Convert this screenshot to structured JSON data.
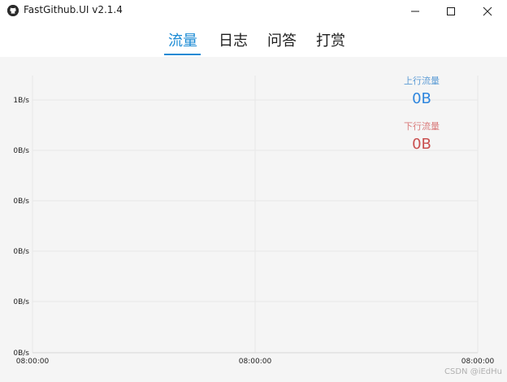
{
  "window": {
    "title": "FastGithub.UI v2.1.4",
    "icon": "github-icon"
  },
  "tabs": [
    {
      "label": "流量",
      "active": true
    },
    {
      "label": "日志",
      "active": false
    },
    {
      "label": "问答",
      "active": false
    },
    {
      "label": "打赏",
      "active": false
    }
  ],
  "legend": {
    "upload_label": "上行流量",
    "upload_value": "0B",
    "download_label": "下行流量",
    "download_value": "0B"
  },
  "colors": {
    "accent": "#1a8ad4",
    "upload": "#2e86de",
    "download": "#c94f4f"
  },
  "chart_data": {
    "type": "line",
    "y_ticks": [
      "1B/s",
      "0B/s",
      "0B/s",
      "0B/s",
      "0B/s",
      "0B/s"
    ],
    "x_ticks": [
      "08:00:00",
      "08:00:00",
      "08:00:00"
    ],
    "series": [
      {
        "name": "上行流量",
        "values": []
      },
      {
        "name": "下行流量",
        "values": []
      }
    ],
    "grid": true,
    "legend": "top-right"
  },
  "watermark": "CSDN @iEdHu"
}
